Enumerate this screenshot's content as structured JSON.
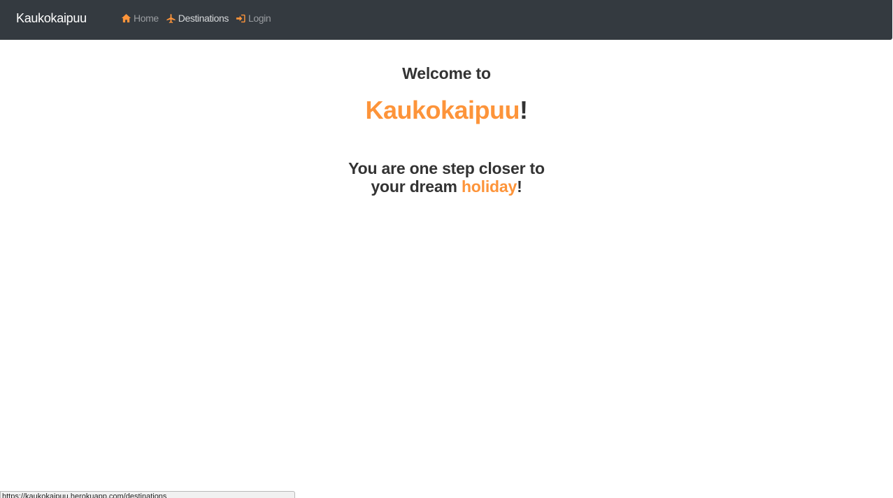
{
  "navbar": {
    "brand": "Kaukokaipuu",
    "items": [
      {
        "label": "Home",
        "icon": "home-icon",
        "state": "muted"
      },
      {
        "label": "Destinations",
        "icon": "plane-icon",
        "state": "active"
      },
      {
        "label": "Login",
        "icon": "login-icon",
        "state": "muted"
      }
    ]
  },
  "hero": {
    "welcome": "Welcome to",
    "brand_name": "Kaukokaipuu",
    "brand_suffix": "!",
    "tagline_line1": "You are one step closer to",
    "tagline_line2_prefix": "your dream ",
    "tagline_highlight": "holiday",
    "tagline_suffix": "!"
  },
  "status_bar": {
    "url": "https://kaukokaipuu.herokuapp.com/destinations"
  },
  "colors": {
    "navbar_bg": "#343a40",
    "accent": "#fd943a",
    "text": "#333333"
  }
}
